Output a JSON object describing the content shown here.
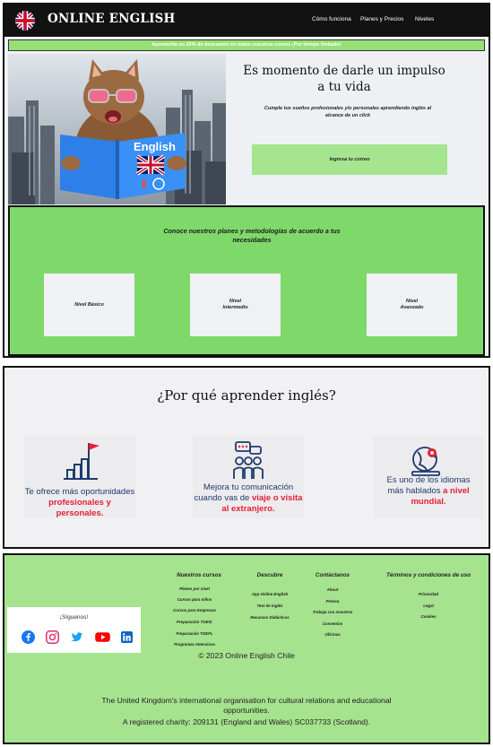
{
  "nav": {
    "brand": "ONLINE ENGLISH",
    "links": [
      "Cómo funciona",
      "Planes y Precios",
      "Niveles"
    ]
  },
  "promo": "Aprovecha un 25% de descuento en todos nuestros cursos ¡Por tiempo limitado!",
  "hero": {
    "title_line1": "Es momento de darle un impulso",
    "title_line2": "a tu vida",
    "subtitle_line1": "Cumple tus sueños profesionales y/o personales aprendiendo inglés al",
    "subtitle_line2": "alcance de un click",
    "email_button": "Ingresa tu correo",
    "book_word": "English"
  },
  "plans": {
    "title_line1": "Conoce nuestros planes y metodologías de acuerdo a tus",
    "title_line2": "necesidades",
    "cards": [
      {
        "line1": "Nivel Básico",
        "line2": ""
      },
      {
        "line1": "Nivel",
        "line2": "Intermedio"
      },
      {
        "line1": "Nivel",
        "line2": "Avanzado"
      }
    ]
  },
  "why": {
    "title": "¿Por qué aprender inglés?",
    "cards": [
      {
        "l1": "Te ofrece más oportunidades",
        "l2_hl": "profesionales y personales.",
        "icon": "chart-flag-icon"
      },
      {
        "l1": "Mejora tu comunicación",
        "l2_pre": "cuando vas de ",
        "l2_hl": "viaje o visita",
        "l3_hl": "al extranjero.",
        "icon": "people-chat-icon"
      },
      {
        "l1": "Es uno de los idiomas",
        "l2_pre": "más hablados ",
        "l2_hl": "a nivel",
        "l3_hl": "mundial.",
        "icon": "globe-icon"
      }
    ]
  },
  "footer": {
    "social_label": "¡Síguenos!",
    "social": [
      "facebook-icon",
      "instagram-icon",
      "twitter-icon",
      "youtube-icon",
      "linkedin-icon"
    ],
    "cols": [
      {
        "head": "Nuestros cursos",
        "items": [
          "Planes por nivel",
          "Cursos para niños",
          "Cursos para Empresas",
          "Preparación TOEIC",
          "Preparación TOEFL",
          "Programas Intensivos"
        ]
      },
      {
        "head": "Descubre",
        "items": [
          "App Online English",
          "Test de inglés",
          "Recursos Didácticos"
        ]
      },
      {
        "head": "Contáctanos",
        "items": [
          "About",
          "Prensa",
          "Trabaja con nosotros",
          "Convenios",
          "Oficinas"
        ]
      },
      {
        "head": "Términos y condiciones de uso",
        "items": [
          "Privacidad",
          "Legal",
          "Cookies"
        ]
      }
    ],
    "copyright": "© 2023 Online English Chile",
    "council_line1": "The United Kingdom's international organisation for cultural relations and educational",
    "council_line2": "opportunities.",
    "council_line3": "A registered charity: 209131 (England and Wales) SC037733 (Scotland)."
  },
  "colors": {
    "green": "#7ed96a",
    "light_green": "#a6e38e",
    "navy": "#1f3b6e",
    "red": "#e42136",
    "dark": "#121212"
  }
}
